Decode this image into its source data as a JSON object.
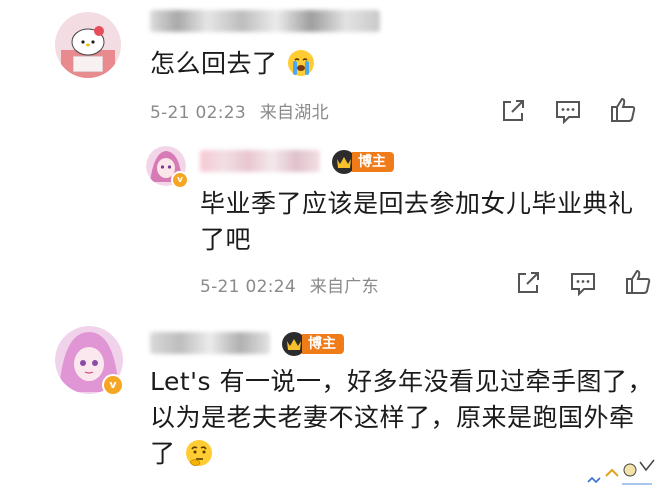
{
  "comments": [
    {
      "text": "怎么回去了",
      "emoji": "crying-face",
      "time": "5-21 02:23",
      "location": "来自湖北"
    },
    {
      "badge": "博主",
      "text_line1": "毕业季了应该是回去参加女儿毕业典礼",
      "text_line2": "了吧",
      "time": "5-21 02:24",
      "location": "来自广东"
    },
    {
      "badge": "博主",
      "text_line1": "Let's 有一说一，好多年没看见过牵手图了，",
      "text_line2": "以为是老夫老妻不这样了，原来是跑国外牵",
      "text_line3": "了",
      "emoji": "thinking-face"
    }
  ],
  "colors": {
    "badge": "#f07c19",
    "meta_text": "#8a8a8a"
  }
}
